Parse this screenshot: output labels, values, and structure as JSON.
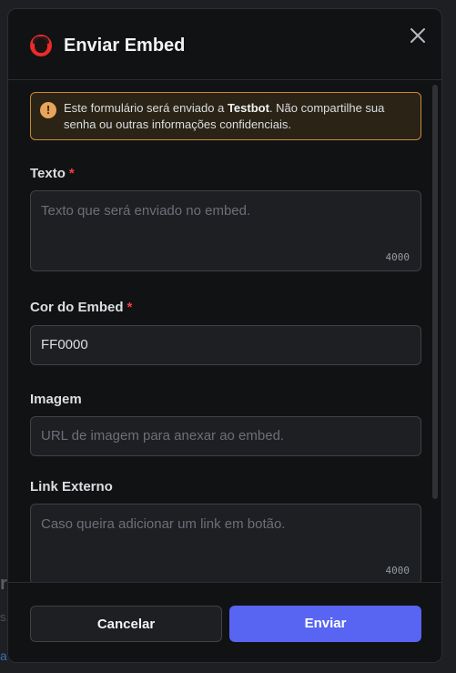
{
  "backdrop": {
    "fragment_1": "r",
    "fragment_2": "s.",
    "fragment_3": "a"
  },
  "modal": {
    "title": "Enviar Embed",
    "app_icon": "bot-avatar-icon",
    "close_icon": "close-icon"
  },
  "warning": {
    "icon": "exclamation-icon",
    "prefix": "Este formulário será enviado a ",
    "bot_name": "Testbot",
    "suffix": ". Não compartilhe sua senha ou outras informações confidenciais.",
    "accent_color": "#c98a33"
  },
  "fields": {
    "texto": {
      "label": "Texto",
      "required_mark": "*",
      "placeholder": "Texto que será enviado no embed.",
      "counter": "4000"
    },
    "cor": {
      "label": "Cor do Embed",
      "required_mark": "*",
      "value": "FF0000"
    },
    "imagem": {
      "label": "Imagem",
      "placeholder": "URL de imagem para anexar ao embed."
    },
    "link": {
      "label": "Link Externo",
      "placeholder": "Caso queira adicionar um link em botão.",
      "counter": "4000"
    }
  },
  "footer": {
    "cancel_label": "Cancelar",
    "send_label": "Enviar",
    "send_color": "#5865f2"
  }
}
